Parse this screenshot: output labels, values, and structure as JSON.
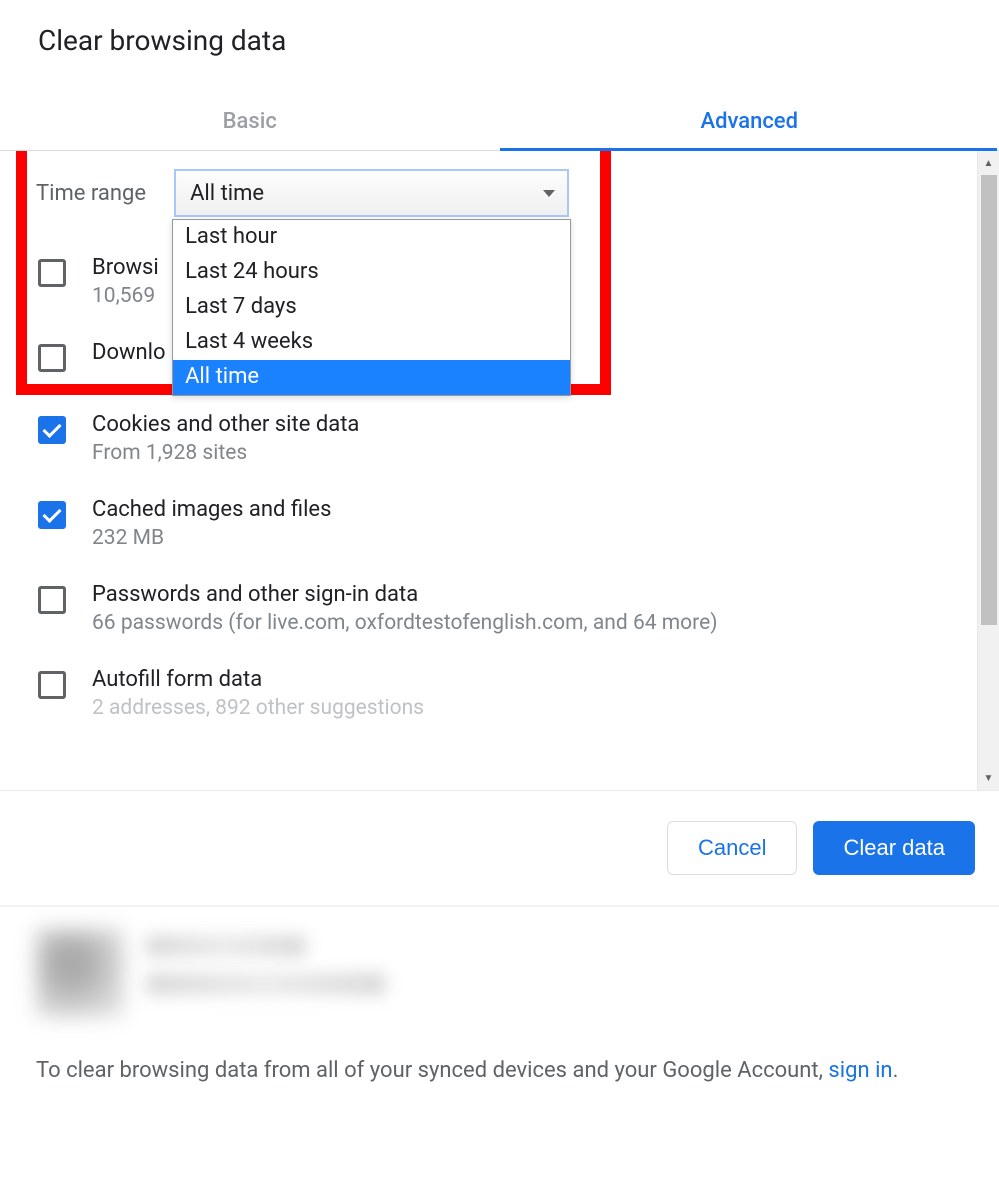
{
  "title": "Clear browsing data",
  "tabs": {
    "basic": "Basic",
    "advanced": "Advanced"
  },
  "time_range": {
    "label": "Time range",
    "selected": "All time",
    "options": [
      "Last hour",
      "Last 24 hours",
      "Last 7 days",
      "Last 4 weeks",
      "All time"
    ]
  },
  "items": {
    "browsing": {
      "title": "Browsi",
      "desc": "10,569",
      "checked": false
    },
    "downloads": {
      "title": "Downlo",
      "desc": "",
      "checked": false
    },
    "cookies": {
      "title": "Cookies and other site data",
      "desc": "From 1,928 sites",
      "checked": true
    },
    "cache": {
      "title": "Cached images and files",
      "desc": "232 MB",
      "checked": true
    },
    "passwords": {
      "title": "Passwords and other sign-in data",
      "desc": "66 passwords (for live.com, oxfordtestofenglish.com, and 64 more)",
      "checked": false
    },
    "autofill": {
      "title": "Autofill form data",
      "desc": "2 addresses, 892 other suggestions",
      "checked": false
    }
  },
  "buttons": {
    "cancel": "Cancel",
    "clear": "Clear data"
  },
  "sync": {
    "text": "To clear browsing data from all of your synced devices and your Google Account, ",
    "link": "sign in",
    "period": "."
  }
}
